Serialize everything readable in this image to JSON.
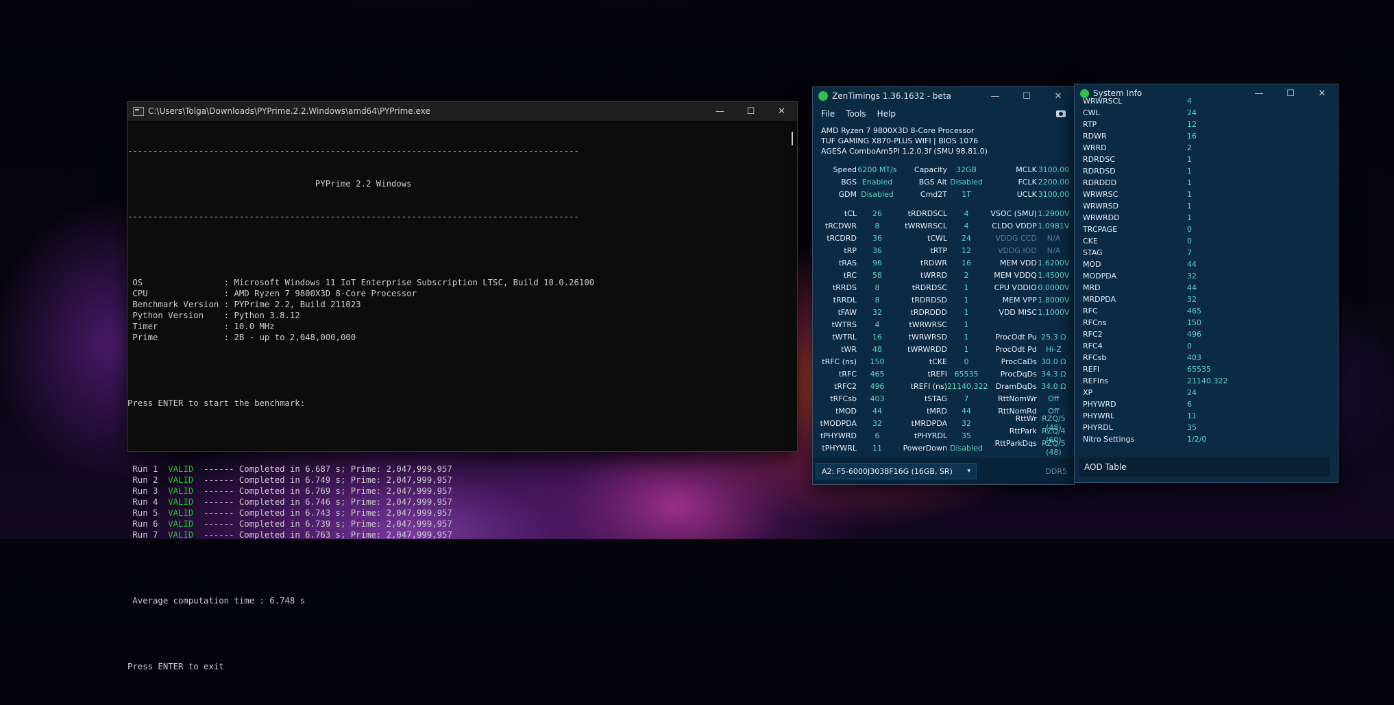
{
  "console": {
    "title": "C:\\Users\\Tolga\\Downloads\\PYPrime.2.2.Windows\\amd64\\PYPrime.exe",
    "rule": "-----------------------------------------------------------------------------------------",
    "header": "                                     PYPrime 2.2 Windows",
    "info": [
      {
        "k": " OS                : ",
        "v": "Microsoft Windows 11 IoT Enterprise Subscription LTSC, Build 10.0.26100"
      },
      {
        "k": " CPU               : ",
        "v": "AMD Ryzen 7 9800X3D 8-Core Processor"
      },
      {
        "k": " Benchmark Version : ",
        "v": "PYPrime 2.2, Build 211023"
      },
      {
        "k": " Python Version    : ",
        "v": "Python 3.8.12"
      },
      {
        "k": " Timer             : ",
        "v": "10.0 MHz"
      },
      {
        "k": " Prime             : ",
        "v": "2B - up to 2,048,000,000"
      }
    ],
    "start_prompt": "Press ENTER to start the benchmark:",
    "runs": [
      {
        "label": " Run 1  ",
        "status": "VALID",
        "text": "  ------ Completed in 6.687 s; Prime: 2,047,999,957"
      },
      {
        "label": " Run 2  ",
        "status": "VALID",
        "text": "  ------ Completed in 6.749 s; Prime: 2,047,999,957"
      },
      {
        "label": " Run 3  ",
        "status": "VALID",
        "text": "  ------ Completed in 6.769 s; Prime: 2,047,999,957"
      },
      {
        "label": " Run 4  ",
        "status": "VALID",
        "text": "  ------ Completed in 6.746 s; Prime: 2,047,999,957"
      },
      {
        "label": " Run 5  ",
        "status": "VALID",
        "text": "  ------ Completed in 6.743 s; Prime: 2,047,999,957"
      },
      {
        "label": " Run 6  ",
        "status": "VALID",
        "text": "  ------ Completed in 6.739 s; Prime: 2,047,999,957"
      },
      {
        "label": " Run 7  ",
        "status": "VALID",
        "text": "  ------ Completed in 6.763 s; Prime: 2,047,999,957"
      }
    ],
    "average": " Average computation time : 6.748 s",
    "exit_prompt": "Press ENTER to exit"
  },
  "zentimings": {
    "title": "ZenTimings 1.36.1632 - beta",
    "menu": [
      "File",
      "Tools",
      "Help"
    ],
    "cpu": "AMD Ryzen 7 9800X3D 8-Core Processor",
    "board": "TUF GAMING X870-PLUS WIFI | BIOS 1076",
    "agesa": "AGESA ComboAm5PI 1.2.0.3f (SMU 98.81.0)",
    "top_rows": [
      [
        [
          "Speed",
          "6200 MT/s"
        ],
        [
          "Capacity",
          "32GB"
        ],
        [
          "MCLK",
          "3100.00"
        ]
      ],
      [
        [
          "BGS",
          "Enabled"
        ],
        [
          "BGS Alt",
          "Disabled"
        ],
        [
          "FCLK",
          "2200.00"
        ]
      ],
      [
        [
          "GDM",
          "Disabled"
        ],
        [
          "Cmd2T",
          "1T"
        ],
        [
          "UCLK",
          "3100.00"
        ]
      ]
    ],
    "rows": [
      [
        [
          "tCL",
          "26"
        ],
        [
          "tRDRDSCL",
          "4"
        ],
        [
          "VSOC (SMU)",
          "1.2900V"
        ]
      ],
      [
        [
          "tRCDWR",
          "8"
        ],
        [
          "tWRWRSCL",
          "4"
        ],
        [
          "CLDO VDDP",
          "1.0981V"
        ]
      ],
      [
        [
          "tRCDRD",
          "36"
        ],
        [
          "tCWL",
          "24"
        ],
        [
          "VDDG CCD",
          "N/A"
        ]
      ],
      [
        [
          "tRP",
          "36"
        ],
        [
          "tRTP",
          "12"
        ],
        [
          "VDDG IOD",
          "N/A"
        ]
      ],
      [
        [
          "tRAS",
          "96"
        ],
        [
          "tRDWR",
          "16"
        ],
        [
          "MEM VDD",
          "1.6200V"
        ]
      ],
      [
        [
          "tRC",
          "58"
        ],
        [
          "tWRRD",
          "2"
        ],
        [
          "MEM VDDQ",
          "1.4500V"
        ]
      ],
      [
        [
          "tRRDS",
          "8"
        ],
        [
          "tRDRDSC",
          "1"
        ],
        [
          "CPU VDDIO",
          "0.0000V"
        ]
      ],
      [
        [
          "tRRDL",
          "8"
        ],
        [
          "tRDRDSD",
          "1"
        ],
        [
          "MEM VPP",
          "1.8000V"
        ]
      ],
      [
        [
          "tFAW",
          "32"
        ],
        [
          "tRDRDDD",
          "1"
        ],
        [
          "VDD MISC",
          "1.1000V"
        ]
      ],
      [
        [
          "tWTRS",
          "4"
        ],
        [
          "tWRWRSC",
          "1"
        ],
        [
          "",
          ""
        ]
      ],
      [
        [
          "tWTRL",
          "16"
        ],
        [
          "tWRWRSD",
          "1"
        ],
        [
          "ProcOdt Pu",
          "25.3 Ω"
        ]
      ],
      [
        [
          "tWR",
          "48"
        ],
        [
          "tWRWRDD",
          "1"
        ],
        [
          "ProcOdt Pd",
          "Hi-Z"
        ]
      ],
      [
        [
          "tRFC (ns)",
          "150"
        ],
        [
          "tCKE",
          "0"
        ],
        [
          "ProcCaDs",
          "30.0 Ω"
        ]
      ],
      [
        [
          "tRFC",
          "465"
        ],
        [
          "tREFI",
          "65535"
        ],
        [
          "ProcDqDs",
          "34.3 Ω"
        ]
      ],
      [
        [
          "tRFC2",
          "496"
        ],
        [
          "tREFI (ns)",
          "21140.322"
        ],
        [
          "DramDqDs",
          "34.0 Ω"
        ]
      ],
      [
        [
          "tRFCsb",
          "403"
        ],
        [
          "tSTAG",
          "7"
        ],
        [
          "RttNomWr",
          "Off"
        ]
      ],
      [
        [
          "tMOD",
          "44"
        ],
        [
          "tMRD",
          "44"
        ],
        [
          "RttNomRd",
          "Off"
        ]
      ],
      [
        [
          "tMODPDA",
          "32"
        ],
        [
          "tMRDPDA",
          "32"
        ],
        [
          "RttWr",
          "RZQ/5 (48)"
        ]
      ],
      [
        [
          "tPHYWRD",
          "6"
        ],
        [
          "tPHYRDL",
          "35"
        ],
        [
          "RttPark",
          "RZQ/4 (60)"
        ]
      ],
      [
        [
          "tPHYWRL",
          "11"
        ],
        [
          "PowerDown",
          "Disabled"
        ],
        [
          "RttParkDqs",
          "RZQ/5 (48)"
        ]
      ]
    ],
    "dimm": "A2: F5-6000J3038F16G (16GB, SR)",
    "mem_type": "DDR5"
  },
  "sysinfo": {
    "title": "System Info",
    "rows": [
      [
        "WRWRSCL",
        "4"
      ],
      [
        "CWL",
        "24"
      ],
      [
        "RTP",
        "12"
      ],
      [
        "RDWR",
        "16"
      ],
      [
        "WRRD",
        "2"
      ],
      [
        "RDRDSC",
        "1"
      ],
      [
        "RDRDSD",
        "1"
      ],
      [
        "RDRDDD",
        "1"
      ],
      [
        "WRWRSC",
        "1"
      ],
      [
        "WRWRSD",
        "1"
      ],
      [
        "WRWRDD",
        "1"
      ],
      [
        "TRCPAGE",
        "0"
      ],
      [
        "CKE",
        "0"
      ],
      [
        "STAG",
        "7"
      ],
      [
        "MOD",
        "44"
      ],
      [
        "MODPDA",
        "32"
      ],
      [
        "MRD",
        "44"
      ],
      [
        "MRDPDA",
        "32"
      ],
      [
        "RFC",
        "465"
      ],
      [
        "RFCns",
        "150"
      ],
      [
        "RFC2",
        "496"
      ],
      [
        "RFC4",
        "0"
      ],
      [
        "RFCsb",
        "403"
      ],
      [
        "REFI",
        "65535"
      ],
      [
        "REFIns",
        "21140.322"
      ],
      [
        "XP",
        "24"
      ],
      [
        "PHYWRD",
        "6"
      ],
      [
        "PHYWRL",
        "11"
      ],
      [
        "PHYRDL",
        "35"
      ],
      [
        "Nitro Settings",
        "1/2/0"
      ]
    ],
    "footer": "AOD Table"
  },
  "colors": {
    "valid": "#23c52e",
    "value": "#5ed8c0",
    "panel": "#0b2a44"
  }
}
